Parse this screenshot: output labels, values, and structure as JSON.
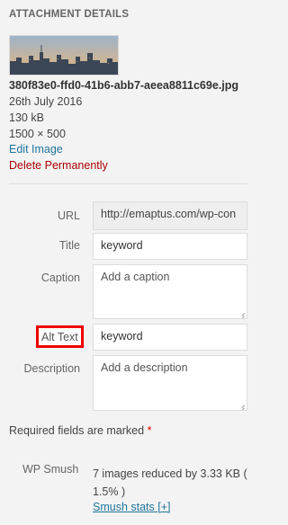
{
  "heading": "ATTACHMENT DETAILS",
  "file": {
    "name": "380f83e0-ffd0-41b6-abb7-aeea8811c69e.jpg",
    "date": "26th July 2016",
    "size": "130 kB",
    "dimensions": "1500 × 500"
  },
  "actions": {
    "edit_image": "Edit Image",
    "delete_permanently": "Delete Permanently"
  },
  "fields": {
    "url": {
      "label": "URL",
      "value": "http://emaptus.com/wp-con"
    },
    "title": {
      "label": "Title",
      "value": "keyword"
    },
    "caption": {
      "label": "Caption",
      "placeholder": "Add a caption"
    },
    "alt_text": {
      "label": "Alt Text",
      "value": "keyword"
    },
    "description": {
      "label": "Description",
      "placeholder": "Add a description"
    }
  },
  "required_note": "Required fields are marked",
  "required_star": "*",
  "smush": {
    "label": "WP Smush",
    "info": "7 images reduced by 3.33 KB ( 1.5% )",
    "stats_link": "Smush stats [+]"
  },
  "colors": {
    "link": "#21759b",
    "delete": "#aa0000",
    "highlight_border": "#ee0000",
    "background": "#f3f3f3"
  }
}
